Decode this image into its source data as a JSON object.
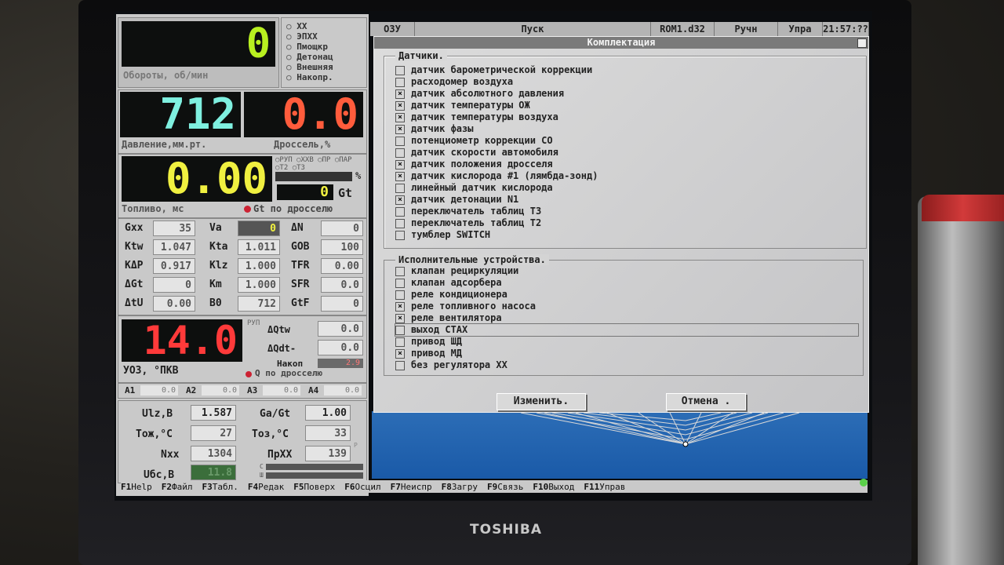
{
  "top_bar": {
    "items": [
      "ОЗУ",
      "Пуск",
      "ROM1.d32",
      "Ручн",
      "Упра",
      "21:57:??"
    ]
  },
  "rpm": {
    "value": "0",
    "label": "Обороты, об/мин",
    "color": "#b8f020"
  },
  "status_flags": {
    "items": [
      "ХХ",
      "ЭПХХ",
      "Пмощкр",
      "Детонац",
      "Внешняя",
      "Накопр."
    ]
  },
  "pressure": {
    "value": "712",
    "label": "Давление,мм.рт.",
    "color": "#7ff0e0"
  },
  "throttle": {
    "value": "0.0",
    "label": "Дроссель,%",
    "color": "#ff5c3c"
  },
  "fuel": {
    "value": "0.00",
    "label": "Топливо, мс",
    "color": "#f0f040",
    "flags": [
      "РУП",
      "ХХВ",
      "ПР",
      "ПАР",
      "Т2",
      "Т3"
    ],
    "pct": "%",
    "gt_value": "0",
    "gt_label": "Gt",
    "by_throttle": "Gt по дросселю"
  },
  "params": {
    "gxx": {
      "label": "Gxx",
      "value": "35"
    },
    "va": {
      "label": "Va",
      "value": "0"
    },
    "dn": {
      "label": "ΔN",
      "value": "0"
    },
    "ktw": {
      "label": "Ktw",
      "value": "1.047"
    },
    "kta": {
      "label": "Kta",
      "value": "1.011"
    },
    "gob": {
      "label": "GОВ",
      "value": "100"
    },
    "kdp": {
      "label": "KΔP",
      "value": "0.917"
    },
    "klz": {
      "label": "Klz",
      "value": "1.000"
    },
    "tfr": {
      "label": "TFR",
      "value": "0.00"
    },
    "dgt": {
      "label": "ΔGt",
      "value": "0"
    },
    "km": {
      "label": "Km",
      "value": "1.000"
    },
    "sfr": {
      "label": "SFR",
      "value": "0.0"
    },
    "dtu": {
      "label": "ΔtU",
      "value": "0.00"
    },
    "b0": {
      "label": "В0",
      "value": "712"
    },
    "gtf": {
      "label": "GtF",
      "value": "0"
    }
  },
  "uoz": {
    "value": "14.0",
    "label": "УОЗ, °ПКВ",
    "color": "#ff3a3a",
    "rup": "РУП",
    "dqtw_label": "ΔQtw",
    "dqtw_value": "0.0",
    "dqdt_label": "ΔQdt-",
    "dqdt_value": "0.0",
    "nakop_label": "Накоп",
    "nakop_value": "2.9",
    "by_throttle": "Q по дросселю"
  },
  "analog": {
    "a1_label": "A1",
    "a1": "0.0",
    "a2_label": "A2",
    "a2": "0.0",
    "a3_label": "A3",
    "a3": "0.0",
    "a4_label": "A4",
    "a4": "0.0"
  },
  "bottom_params": {
    "ulz": {
      "label": "Ulz,В",
      "value": "1.587"
    },
    "gagt": {
      "label": "Ga/Gt",
      "value": "1.00"
    },
    "tozh": {
      "label": "Тож,°С",
      "value": "27"
    },
    "toz": {
      "label": "Тоз,°С",
      "value": "33"
    },
    "nxx": {
      "label": "Nxx",
      "value": "1304"
    },
    "prxx": {
      "label": "ПрХХ",
      "value": "139"
    },
    "ubs": {
      "label": "Uбс,В",
      "value": "11.8"
    },
    "bar_c": "С",
    "bar_w": "Ш",
    "p_mark": "Р"
  },
  "dialog": {
    "title": "Комплектация",
    "sensors_title": "Датчики.",
    "sensors": [
      {
        "label": "датчик барометрической коррекции",
        "checked": false
      },
      {
        "label": "расходомер воздуха",
        "checked": false
      },
      {
        "label": "датчик абсолютного давления",
        "checked": true
      },
      {
        "label": "датчик температуры ОЖ",
        "checked": true
      },
      {
        "label": "датчик температуры воздуха",
        "checked": true
      },
      {
        "label": "датчик фазы",
        "checked": true
      },
      {
        "label": "потенциометр коррекции СО",
        "checked": false
      },
      {
        "label": "датчик скорости автомобиля",
        "checked": false
      },
      {
        "label": "датчик положения дросселя",
        "checked": true
      },
      {
        "label": "датчик кислорода #1 (лямбда-зонд)",
        "checked": true
      },
      {
        "label": "линейный датчик кислорода",
        "checked": false
      },
      {
        "label": "датчик детонации N1",
        "checked": true
      },
      {
        "label": "переключатель таблиц Т3",
        "checked": false
      },
      {
        "label": "переключатель таблиц Т2",
        "checked": false
      },
      {
        "label": "тумблер SWITCH",
        "checked": false
      }
    ],
    "actuators_title": "Исполнительные устройства.",
    "actuators": [
      {
        "label": "клапан рециркуляции",
        "checked": false
      },
      {
        "label": "клапан адсорбера",
        "checked": false
      },
      {
        "label": "реле кондиционера",
        "checked": false
      },
      {
        "label": "реле топливного насоса",
        "checked": true
      },
      {
        "label": "реле вентилятора",
        "checked": true
      },
      {
        "label": "выход СТАХ",
        "checked": false
      },
      {
        "label": "привод ШД",
        "checked": false
      },
      {
        "label": "привод МД",
        "checked": true
      },
      {
        "label": "без регулятора ХХ",
        "checked": false
      }
    ],
    "ok_label": "Изменить.",
    "cancel_label": "Отмена ."
  },
  "fkeys": [
    {
      "key": "F1",
      "label": "Help"
    },
    {
      "key": "F2",
      "label": "Файл"
    },
    {
      "key": "F3",
      "label": "Табл."
    },
    {
      "key": "F4",
      "label": "Редак"
    },
    {
      "key": "F5",
      "label": "Поверх"
    },
    {
      "key": "F6",
      "label": "Осцил"
    },
    {
      "key": "F7",
      "label": "Неиспр"
    },
    {
      "key": "F8",
      "label": "Загру"
    },
    {
      "key": "F9",
      "label": "Связь"
    },
    {
      "key": "F10",
      "label": "Выход"
    },
    {
      "key": "F11",
      "label": "Управ"
    }
  ],
  "brand": "TOSHIBA"
}
